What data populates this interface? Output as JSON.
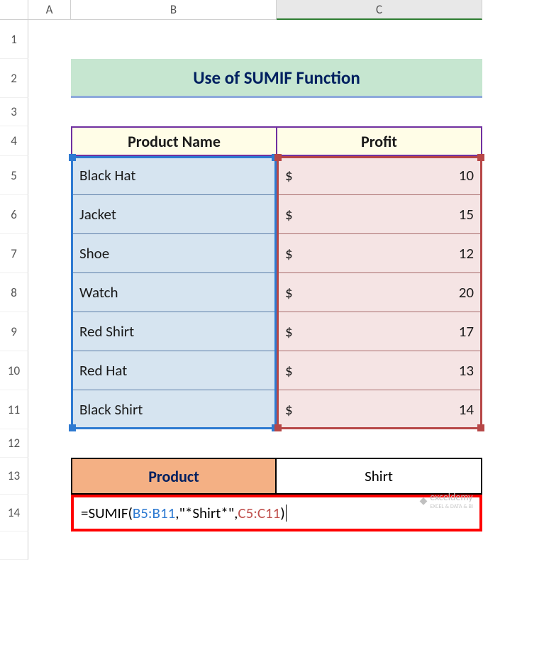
{
  "columns": [
    "A",
    "B",
    "C"
  ],
  "rows": [
    "1",
    "2",
    "3",
    "4",
    "5",
    "6",
    "7",
    "8",
    "9",
    "10",
    "11",
    "12",
    "13",
    "14"
  ],
  "title": "Use of SUMIF Function",
  "headers": {
    "product_name": "Product Name",
    "profit": "Profit"
  },
  "products": [
    {
      "name": "Black Hat",
      "profit": "10"
    },
    {
      "name": "Jacket",
      "profit": "15"
    },
    {
      "name": "Shoe",
      "profit": "12"
    },
    {
      "name": "Watch",
      "profit": "20"
    },
    {
      "name": "Red Shirt",
      "profit": "17"
    },
    {
      "name": "Red Hat",
      "profit": "13"
    },
    {
      "name": "Black Shirt",
      "profit": "14"
    }
  ],
  "currency": "$",
  "lookup": {
    "label": "Product",
    "value": "Shirt"
  },
  "formula": {
    "prefix": "=SUMIF(",
    "range1": "B5:B11",
    "sep1": ",",
    "criteria": "\"*Shirt*\"",
    "sep2": ",",
    "range2": "C5:C11",
    "suffix": ")"
  },
  "watermark": {
    "brand": "exceldemy",
    "tagline": "EXCEL & DATA & BI"
  }
}
